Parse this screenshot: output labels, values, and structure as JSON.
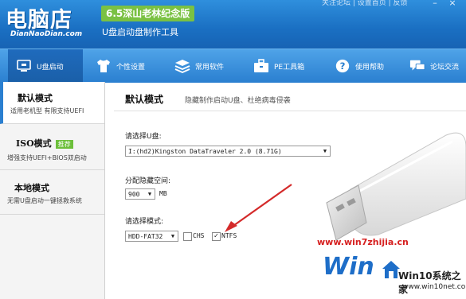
{
  "header": {
    "logo_text": "电脑店",
    "logo_sub": "DianNaoDian.com",
    "version": "6.5深山老林纪念版",
    "tagline": "U盘启动盘制作工具",
    "toplinks": "关注论坛 | 设置首页 | 反馈"
  },
  "nav": {
    "items": [
      {
        "label": "U盘启动",
        "icon": "monitor-icon"
      },
      {
        "label": "个性设置",
        "icon": "shirt-icon"
      },
      {
        "label": "常用软件",
        "icon": "layers-icon"
      },
      {
        "label": "PE工具箱",
        "icon": "briefcase-icon"
      },
      {
        "label": "使用帮助",
        "icon": "help-icon"
      },
      {
        "label": "论坛交流",
        "icon": "chat-icon"
      }
    ]
  },
  "sidebar": {
    "items": [
      {
        "title": "默认模式",
        "desc": "适用老机型 有限支持UEFI"
      },
      {
        "title": "ISO模式",
        "badge": "推荐",
        "desc": "增强支持UEFI+BIOS双启动"
      },
      {
        "title": "本地模式",
        "desc": "无需U盘启动一键拯救系统"
      }
    ]
  },
  "main": {
    "title": "默认模式",
    "subtitle": "隐藏制作启动U盘、杜绝病毒侵袭",
    "select_disk_label": "请选择U盘:",
    "disk_value": "I:(hd2)Kingston DataTraveler 2.0 (8.71G)",
    "partition_label": "分配隐藏空间:",
    "partition_value": "900",
    "partition_unit": "MB",
    "mode_label": "请选择模式:",
    "mode_value": "HDD-FAT32",
    "option_chs": "CHS",
    "option_ntfs": "NTFS",
    "chs_checked": false,
    "ntfs_checked": true
  },
  "watermark": {
    "url": "www.win7zhijia.cn",
    "logo_text": "Win",
    "site_name": "Win10系统之家",
    "site_url": "www.win10net.com"
  },
  "colors": {
    "header_blue": "#1a6fc2",
    "nav_blue": "#2a7fd0",
    "version_green": "#7ac143",
    "arrow_red": "#d42a2a"
  }
}
